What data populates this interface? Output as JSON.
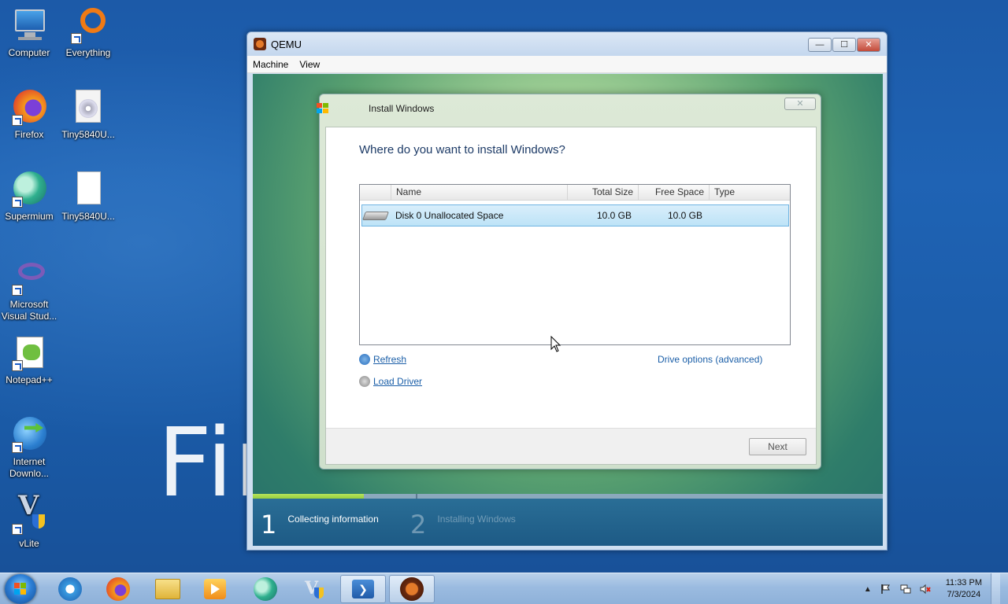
{
  "desktop": {
    "icons": [
      {
        "label": "Computer",
        "icon": "computer-icon"
      },
      {
        "label": "Everything",
        "icon": "everything-icon"
      },
      {
        "label": "Firefox",
        "icon": "firefox-icon"
      },
      {
        "label": "Tiny5840U...",
        "icon": "disc-image-icon"
      },
      {
        "label": "Supermium",
        "icon": "supermium-icon"
      },
      {
        "label": "Tiny5840U...",
        "icon": "document-icon"
      },
      {
        "label": "Microsoft Visual Stud...",
        "icon": "visual-studio-icon"
      },
      {
        "label": "Notepad++",
        "icon": "notepad-plus-plus-icon"
      },
      {
        "label": "Internet Downlo...",
        "icon": "internet-download-manager-icon"
      },
      {
        "label": "vLite",
        "icon": "vlite-icon"
      }
    ],
    "wallpaper_text": "Fir"
  },
  "qemu": {
    "title": "QEMU",
    "menu": [
      "Machine",
      "View"
    ],
    "buttons": {
      "minimize": "—",
      "maximize": "☐",
      "close": "✕"
    }
  },
  "installer": {
    "title": "Install Windows",
    "heading": "Where do you want to install Windows?",
    "columns": [
      "",
      "Name",
      "Total Size",
      "Free Space",
      "Type"
    ],
    "rows": [
      {
        "name": "Disk 0 Unallocated Space",
        "total": "10.0 GB",
        "free": "10.0 GB",
        "type": ""
      }
    ],
    "refresh": "Refresh",
    "load_driver": "Load Driver",
    "drive_options": "Drive options (advanced)",
    "next": "Next"
  },
  "setup_steps": [
    {
      "number": "1",
      "label": "Collecting information",
      "active": true
    },
    {
      "number": "2",
      "label": "Installing Windows",
      "active": false
    }
  ],
  "setup_progress": 0.68,
  "taskbar": {
    "apps": [
      "internet-explorer-icon",
      "firefox-icon",
      "file-explorer-icon",
      "media-player-icon",
      "supermium-icon",
      "vlite-icon",
      "powershell-icon",
      "qemu-icon"
    ],
    "clock_time": "11:33 PM",
    "clock_date": "7/3/2024"
  },
  "colors": {
    "link": "#1b5fa8",
    "selection": "#bde3f7",
    "progress": "#82c12c"
  }
}
